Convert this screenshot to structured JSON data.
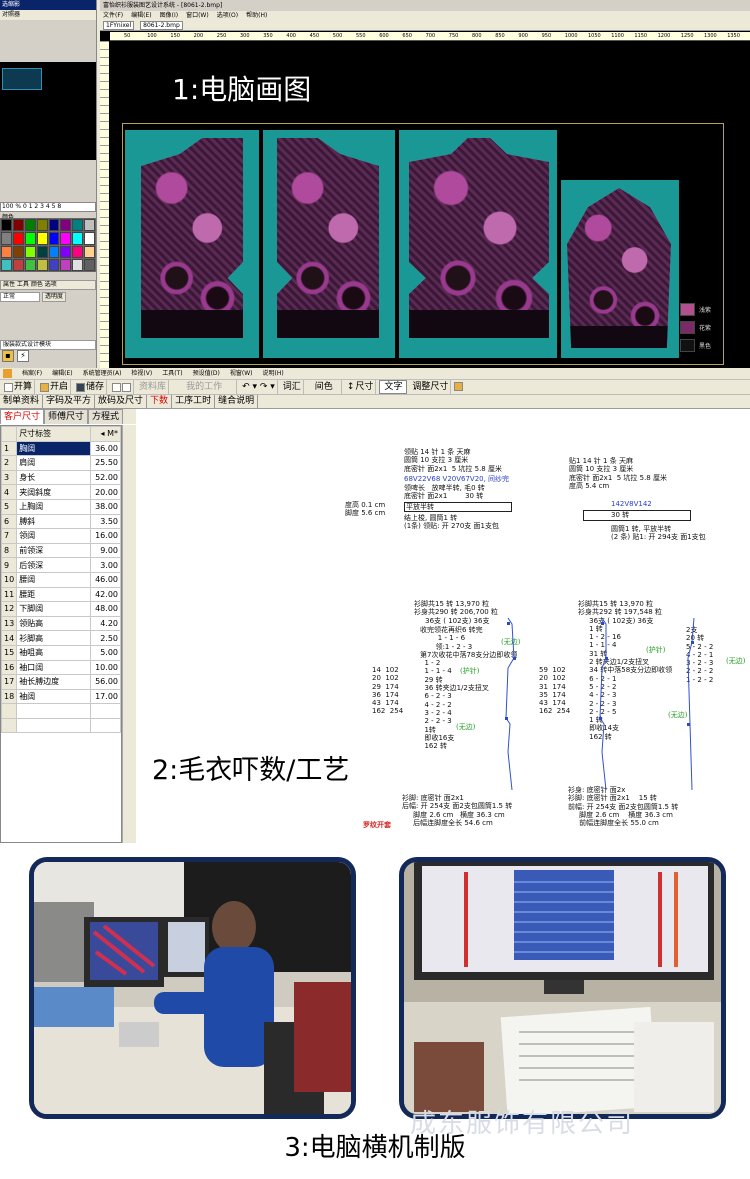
{
  "section1": {
    "heading": "1:电脑画图",
    "left_panel": {
      "title": "选缩影",
      "tab": "对照器",
      "scale": "100 % 0 1 2 3 4 5 8",
      "palette_label": "颜色",
      "row_dropdown": "正常",
      "row_opacity_label": "透明度",
      "row_tabs": "属性 工具 颜色 选项",
      "row_mode": "服装款式设计模块"
    },
    "window": {
      "title": "富怡织衫服装图艺设计系统 - [8061-2.bmp]",
      "menu": [
        "文件(F)",
        "编辑(E)",
        "图像(I)",
        "窗口(W)",
        "选项(O)",
        "帮助(H)"
      ],
      "toolbar_field1": "1FYnixel",
      "toolbar_field2": "8061-2.bmp",
      "ruler_labels": [
        "50",
        "100",
        "150",
        "200",
        "250",
        "300",
        "350",
        "400",
        "450",
        "500",
        "550",
        "600",
        "650",
        "700",
        "750",
        "800",
        "850",
        "900",
        "950",
        "1000",
        "1050",
        "1100",
        "1150",
        "1200",
        "1250",
        "1300",
        "1350"
      ]
    },
    "legend": [
      {
        "label": "浅紫",
        "color": "#b0508e"
      },
      {
        "label": "花紫",
        "color": "#7a2a66"
      },
      {
        "label": "黑色",
        "color": "#111111"
      }
    ],
    "colors": {
      "background": "#000000",
      "teal": "#1a9896",
      "purple": "#b04a9c"
    }
  },
  "section2": {
    "heading": "2:毛衣吓数/工艺",
    "menu": [
      "档案(F)",
      "编辑(E)",
      "系统管理员(A)",
      "检视(V)",
      "工具(T)",
      "预设值(D)",
      "视窗(W)",
      "说明(H)"
    ],
    "toolbar": [
      {
        "label": "开算",
        "enabled": true
      },
      {
        "label": "开启",
        "enabled": true
      },
      {
        "label": "储存",
        "enabled": true
      },
      {
        "label": "资料库",
        "enabled": false
      },
      {
        "label": "我的工作",
        "enabled": false
      },
      {
        "label": "词汇",
        "enabled": true
      },
      {
        "label": "间色",
        "enabled": true
      },
      {
        "label": "尺寸",
        "enabled": true
      },
      {
        "label": "文字",
        "enabled": true
      },
      {
        "label": "调整尺寸",
        "enabled": true
      }
    ],
    "tabs_row1": [
      "制单资料",
      "字码及平方",
      "放码及尺寸",
      "下数",
      "工序工时",
      "缝合说明"
    ],
    "tabs_row1_active": "下数",
    "tabs_row2": [
      "客户尺寸",
      "师傅尺寸",
      "方程式"
    ],
    "grid_header": {
      "label": "尺寸标签",
      "value": "M*"
    },
    "size_rows": [
      {
        "n": "1",
        "label": "胸阔",
        "value": "36.00"
      },
      {
        "n": "2",
        "label": "肩阔",
        "value": "25.50"
      },
      {
        "n": "3",
        "label": "身长",
        "value": "52.00"
      },
      {
        "n": "4",
        "label": "夹阔斜度",
        "value": "20.00"
      },
      {
        "n": "5",
        "label": "上胸阔",
        "value": "38.00"
      },
      {
        "n": "6",
        "label": "膊斜",
        "value": "3.50"
      },
      {
        "n": "7",
        "label": "领阔",
        "value": "16.00"
      },
      {
        "n": "8",
        "label": "前领深",
        "value": "9.00"
      },
      {
        "n": "9",
        "label": "后领深",
        "value": "3.00"
      },
      {
        "n": "10",
        "label": "腰阔",
        "value": "46.00"
      },
      {
        "n": "11",
        "label": "腰距",
        "value": "42.00"
      },
      {
        "n": "12",
        "label": "下脚阔",
        "value": "48.00"
      },
      {
        "n": "13",
        "label": "领贴高",
        "value": "4.20"
      },
      {
        "n": "14",
        "label": "衫脚高",
        "value": "2.50"
      },
      {
        "n": "15",
        "label": "袖咀高",
        "value": "5.00"
      },
      {
        "n": "16",
        "label": "袖口阔",
        "value": "10.00"
      },
      {
        "n": "17",
        "label": "袖长膊边度",
        "value": "56.00"
      },
      {
        "n": "18",
        "label": "袖阔",
        "value": "17.00"
      }
    ],
    "doc": {
      "left_top": "领贴 14 针 1 条 天麻\n圆筒 10 支拉 3 厘米\n底密针 面2x1  5 坑拉 5.8 厘米",
      "left_blue": "68V22V68 V20V67V20, 间纱完",
      "left_mid": "领啤长   放啤半转, 毛0 转\n底密针 面2x1        30 转",
      "left_box": "平放半转",
      "left_after": "结上梭, 圆筒1 转\n(1条) 领贴: 开 270支 面1支包",
      "side_dims": "度高 0.1 cm\n脚度 5.6 cm",
      "right_top": "贴1 14 针 1 条 天麻\n圆筒 10 支拉 3 厘米\n底密针 面2x1  5 坑拉 5.8 厘米\n度高 5.4 cm",
      "right_blue": "142V8V142",
      "right_box": "30 转",
      "right_after": "圆筒1 转, 平放半转\n(2 条) 贴1: 开 294支 面1支包",
      "left_body": "衫脚共15 转 13,970 粒\n衫身共290 转 206,700 粒\n     36支 ( 102支) 36支",
      "left_neck": "收完领花再织6 转完\n        1 - 1 - 6\n       领:1 - 2 - 3\n第7次收花中落78支分边即收领\n  1 - 2\n  1 - 1 - 4\n  29 转\n  36 转夹边1/2支扭叉\n  6 - 2 - 3\n  4 - 2 - 2\n  3 - 2 - 4\n  2 - 2 - 3\n  1转\n  即收16支\n  162 转",
      "left_green1": "(无边)",
      "left_green2": "(护针)",
      "left_green3": "(无边)",
      "left_rows": "14  102\n20  102\n29  174\n36  174\n43  174\n162  254",
      "left_hem": "衫脚: 底密针 面2x1\n后幅: 开 254支 面2支包圆筒1.5 转\n     脚度 2.6 cm   横度 36.3 cm\n     后幅连脚度全长 54.6 cm",
      "right_body": "衫脚共15 转 13,970 粒\n衫身共292 转 197,548 粒\n     36支 ( 102支) 36支\n     1 转\n     1 - 2 - 16\n     1 - 1 - 4\n     31 转\n     2 转夹边1/2支扭叉\n     34 转中落58支分边即收领\n     6 - 2 - 1\n     5 - 2 - 2\n     4 - 2 - 3\n     2 - 2 - 3\n     2 - 2 - 5\n     1 转\n     即收14支\n     162 转",
      "right_green1": "(护针)",
      "right_green2": "(无边)",
      "right_green3": "(无边)",
      "right_collar": "2支\n20 转\n5 - 2 - 2\n4 - 2 - 1\n3 - 2 - 3\n2 - 2 - 2\n1 - 2 - 2",
      "right_rows": "59  102\n20  102\n31  174\n35  174\n43  174\n162  254",
      "right_hem": "衫身: 底密针 面2x\n衫脚: 底密针 面2x1    15 转\n前幅: 开 254支 面2支包圆筒1.5 转\n     脚度 2.6 cm    横度 36.3 cm\n     前幅连脚度全长 55.0 cm",
      "red_label": "罗纹开套"
    }
  },
  "section3": {
    "caption": "3:电脑横机制版",
    "watermark": "成东服饰有限公司",
    "photo_left_alt": "技术人员在电脑前制版",
    "photo_right_alt": "电脑屏幕与纸样"
  }
}
